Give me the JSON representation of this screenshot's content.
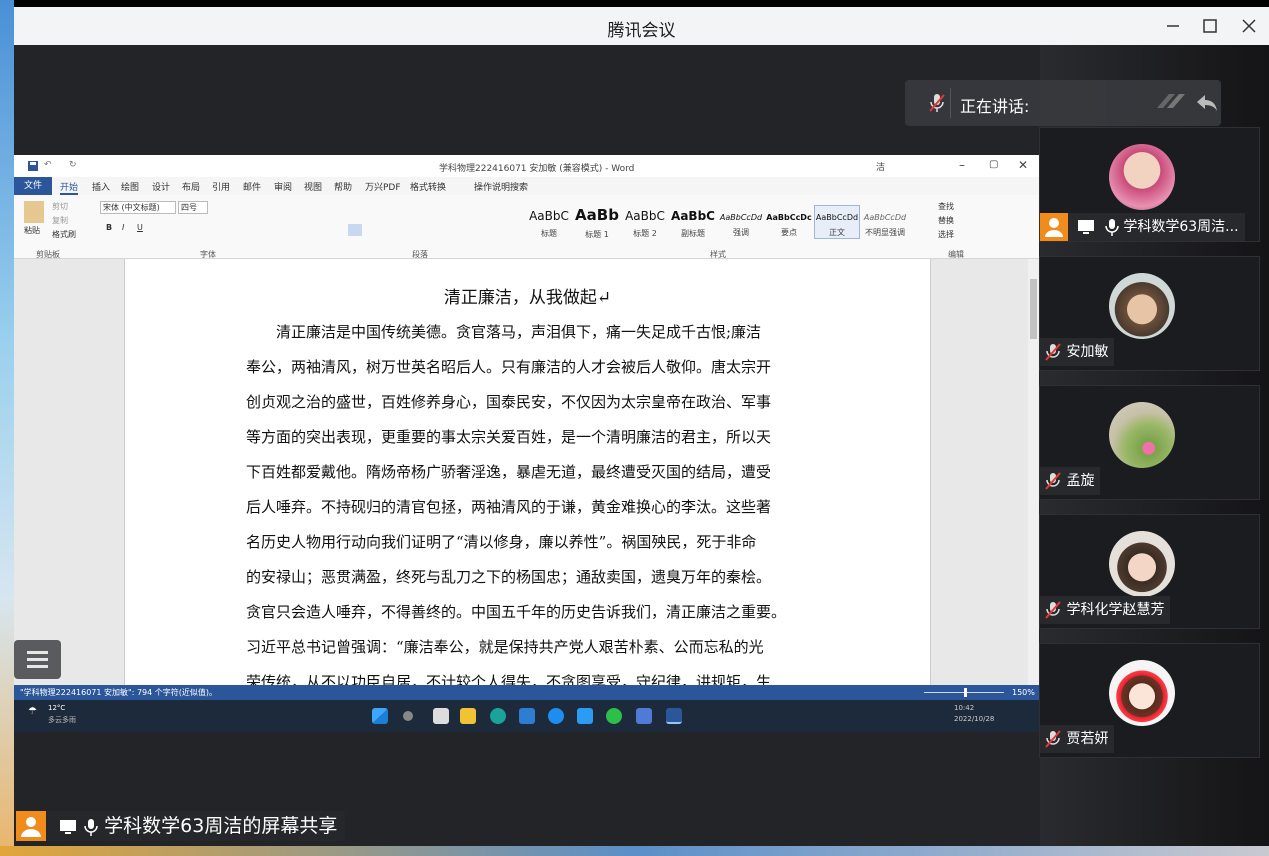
{
  "app": {
    "title": "腾讯会议"
  },
  "speaking": {
    "label": "正在讲话:"
  },
  "participants": [
    {
      "name": "学科数学63周洁...",
      "host": true
    },
    {
      "name": "安加敏"
    },
    {
      "name": "孟旋"
    },
    {
      "name": "学科化学赵慧芳"
    },
    {
      "name": "贾若妍"
    }
  ],
  "share": {
    "label": "学科数学63周洁的屏幕共享"
  },
  "word": {
    "title": "学科物理222416071 安加敏 (兼容模式) - Word",
    "user_initial": "洁",
    "tabs": [
      "文件",
      "开始",
      "插入",
      "绘图",
      "设计",
      "布局",
      "引用",
      "邮件",
      "审阅",
      "视图",
      "帮助",
      "万兴PDF",
      "格式转换",
      "操作说明搜索"
    ],
    "clipboard": {
      "cut": "剪切",
      "copy": "复制",
      "paste": "粘贴",
      "painter": "格式刷",
      "label": "剪贴板"
    },
    "font": {
      "name": "宋体 (中文标题)",
      "size": "四号",
      "label": "字体"
    },
    "paragraph_label": "段落",
    "styles_label": "样式",
    "styles": [
      {
        "preview": "AaBbC",
        "name": "标题"
      },
      {
        "preview": "AaBb",
        "name": "标题 1"
      },
      {
        "preview": "AaBbC",
        "name": "标题 2"
      },
      {
        "preview": "AaBbC",
        "name": "副标题"
      },
      {
        "preview": "AaBbCcDd",
        "name": "强调"
      },
      {
        "preview": "AaBbCcDc",
        "name": "要点"
      },
      {
        "preview": "AaBbCcDd",
        "name": "正文"
      },
      {
        "preview": "AaBbCcDd",
        "name": "不明显强调"
      }
    ],
    "editing": {
      "find": "查找",
      "replace": "替换",
      "select": "选择",
      "label": "编辑"
    },
    "doc_title": "清正廉洁，从我做起↵",
    "doc_lines": [
      "　　清正廉洁是中国传统美德。贪官落马，声泪俱下，痛一失足成千古恨;廉洁",
      "奉公，两袖清风，树万世英名昭后人。只有廉洁的人才会被后人敬仰。唐太宗开",
      "创贞观之治的盛世，百姓修养身心，国泰民安，不仅因为太宗皇帝在政治、军事",
      "等方面的突出表现，更重要的事太宗关爱百姓，是一个清明廉洁的君主，所以天",
      "下百姓都爱戴他。隋炀帝杨广骄奢淫逸，暴虐无道，最终遭受灭国的结局，遭受",
      "后人唾弃。不持砚归的清官包拯，两袖清风的于谦，黄金难换心的李汰。这些著",
      "名历史人物用行动向我们证明了“清以修身，廉以养性”。祸国殃民，死于非命",
      "的安禄山；恶贯满盈，终死与乱刀之下的杨国忠；通敌卖国，遗臭万年的秦桧。",
      "贪官只会造人唾弃，不得善终的。中国五千年的历史告诉我们，清正廉洁之重要。",
      "习近平总书记曾强调：“廉洁奉公，就是保持共产党人艰苦朴素、公而忘私的光",
      "荣传统，从不以功臣自居，不计较个人得失，不贪图享受，守纪律，讲规矩，生"
    ],
    "status_text": "\"学科物理222416071 安加敏\": 794 个字符(近似值)。",
    "zoom": "150%"
  },
  "taskbar": {
    "weather": "12°C",
    "weather_sub": "多云多雨",
    "time": "10:42",
    "date": "2022/10/28"
  }
}
